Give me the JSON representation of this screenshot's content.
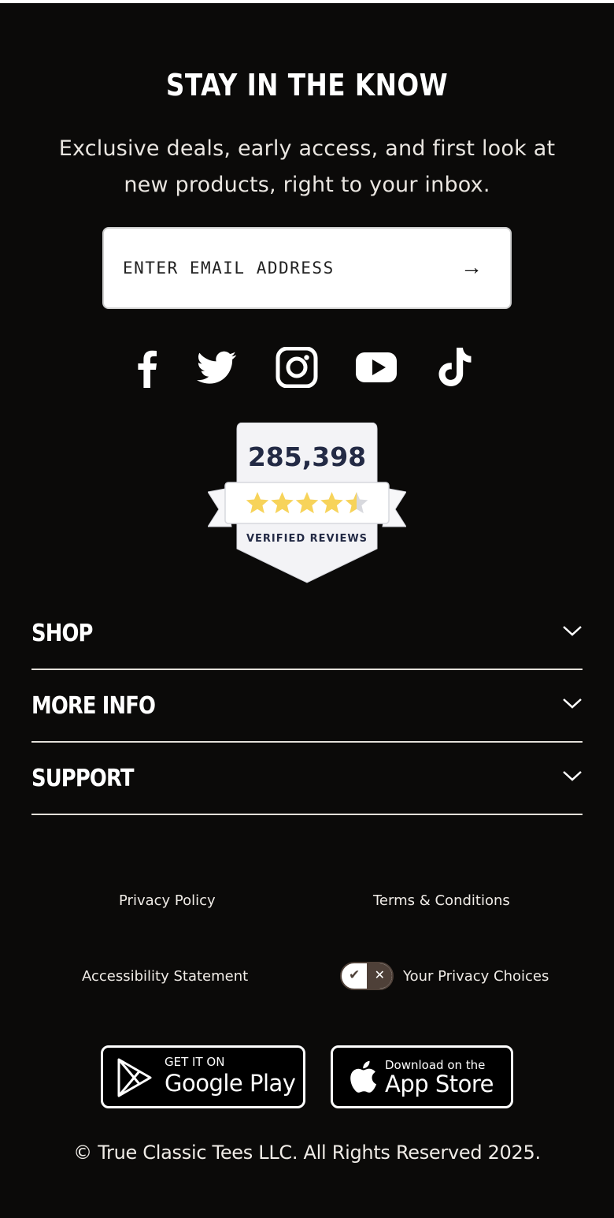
{
  "newsletter": {
    "title": "STAY IN THE KNOW",
    "subtitle_line1": "Exclusive deals, early access, and first look at",
    "subtitle_line2": "new products, right to your inbox.",
    "email_placeholder": "ENTER EMAIL ADDRESS",
    "submit_glyph": "→"
  },
  "social": [
    "facebook-icon",
    "twitter-icon",
    "instagram-icon",
    "youtube-icon",
    "tiktok-icon"
  ],
  "reviews": {
    "count": "285,398",
    "label": "VERIFIED REVIEWS",
    "rating_stars": 4.5,
    "star_color": "#f7d35a"
  },
  "accordion": [
    {
      "label": "SHOP"
    },
    {
      "label": "MORE INFO"
    },
    {
      "label": "SUPPORT"
    }
  ],
  "links": {
    "privacy_policy": "Privacy Policy",
    "terms": "Terms & Conditions",
    "accessibility": "Accessibility Statement",
    "privacy_choices": "Your Privacy Choices"
  },
  "toggle": {
    "on_glyph": "✔",
    "off_glyph": "✕"
  },
  "stores": {
    "google_small": "GET IT ON",
    "google_big": "Google Play",
    "apple_small": "Download on the",
    "apple_big": "App Store"
  },
  "copyright": "© True Classic Tees LLC. All Rights Reserved 2025.",
  "colors": {
    "background": "#0b0a09",
    "badge_text": "#232a45",
    "toggle_dark": "#4e4038"
  }
}
